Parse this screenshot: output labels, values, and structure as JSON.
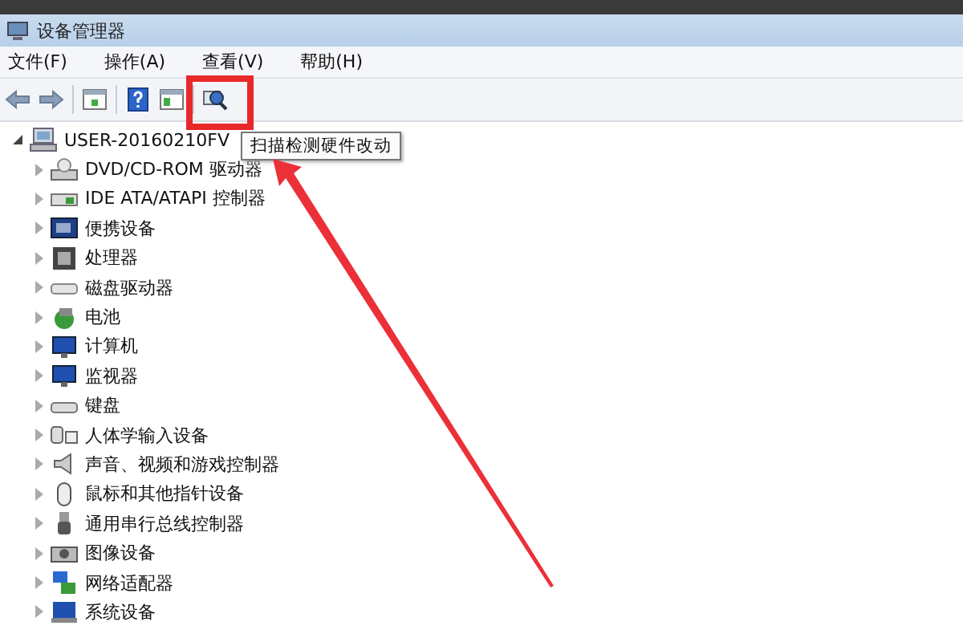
{
  "window": {
    "title": "设备管理器"
  },
  "menu": [
    {
      "label": "文件(F)"
    },
    {
      "label": "操作(A)"
    },
    {
      "label": "查看(V)"
    },
    {
      "label": "帮助(H)"
    }
  ],
  "toolbar": [
    {
      "kind": "back",
      "disabled": false
    },
    {
      "kind": "forward",
      "disabled": false
    },
    {
      "kind": "separator"
    },
    {
      "kind": "properties",
      "disabled": false
    },
    {
      "kind": "separator"
    },
    {
      "kind": "help",
      "disabled": false
    },
    {
      "kind": "view",
      "disabled": false
    },
    {
      "kind": "separator"
    },
    {
      "kind": "scan",
      "disabled": false
    }
  ],
  "tooltip": "扫描检测硬件改动",
  "tree": {
    "label": "USER-20160210FV",
    "expanded": true,
    "children": [
      {
        "label": "DVD/CD-ROM 驱动器",
        "kind": "drive",
        "expanded": false
      },
      {
        "label": "IDE ATA/ATAPI 控制器",
        "kind": "controller",
        "expanded": false
      },
      {
        "label": "便携设备",
        "kind": "portable",
        "expanded": false
      },
      {
        "label": "处理器",
        "kind": "processor",
        "expanded": false
      },
      {
        "label": "磁盘驱动器",
        "kind": "disk",
        "expanded": false
      },
      {
        "label": "电池",
        "kind": "battery",
        "expanded": false
      },
      {
        "label": "计算机",
        "kind": "computer",
        "expanded": false
      },
      {
        "label": "监视器",
        "kind": "monitor",
        "expanded": false
      },
      {
        "label": "键盘",
        "kind": "keyboard",
        "expanded": false
      },
      {
        "label": "人体学输入设备",
        "kind": "hid",
        "expanded": false
      },
      {
        "label": "声音、视频和游戏控制器",
        "kind": "sound",
        "expanded": false
      },
      {
        "label": "鼠标和其他指针设备",
        "kind": "mouse",
        "expanded": false
      },
      {
        "label": "通用串行总线控制器",
        "kind": "usb",
        "expanded": false
      },
      {
        "label": "图像设备",
        "kind": "imaging",
        "expanded": false
      },
      {
        "label": "网络适配器",
        "kind": "network",
        "expanded": false
      },
      {
        "label": "系统设备",
        "kind": "system",
        "expanded": false
      }
    ]
  }
}
